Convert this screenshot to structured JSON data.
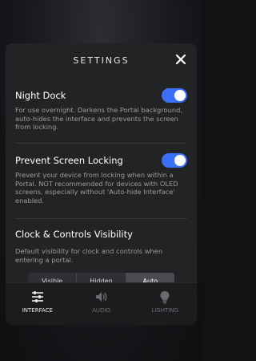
{
  "header": {
    "title": "SETTINGS"
  },
  "settings": [
    {
      "title": "Night Dock",
      "description": "For use overnight. Darkens the Portal background, auto-hides the interface and prevents the screen from locking.",
      "enabled": true
    },
    {
      "title": "Prevent Screen Locking",
      "description": "Prevent your device from locking when within a Portal. NOT recommended for devices with OLED screens, especially without 'Auto-hide Interface' enabled.",
      "enabled": true
    },
    {
      "title": "Clock & Controls Visibility",
      "description": "Default visibility for clock and controls when entering a portal.",
      "options": [
        "Visible",
        "Hidden",
        "Auto"
      ],
      "selected": "Auto"
    }
  ],
  "tabs": [
    {
      "label": "INTERFACE",
      "icon": "sliders-icon",
      "active": true
    },
    {
      "label": "AUDIO",
      "icon": "speaker-icon",
      "active": false
    },
    {
      "label": "LIGHTING",
      "icon": "bulb-icon",
      "active": false
    }
  ],
  "colors": {
    "accent": "#3b6ff5",
    "panel": "#222325",
    "muted_text": "#9a9b9e"
  }
}
